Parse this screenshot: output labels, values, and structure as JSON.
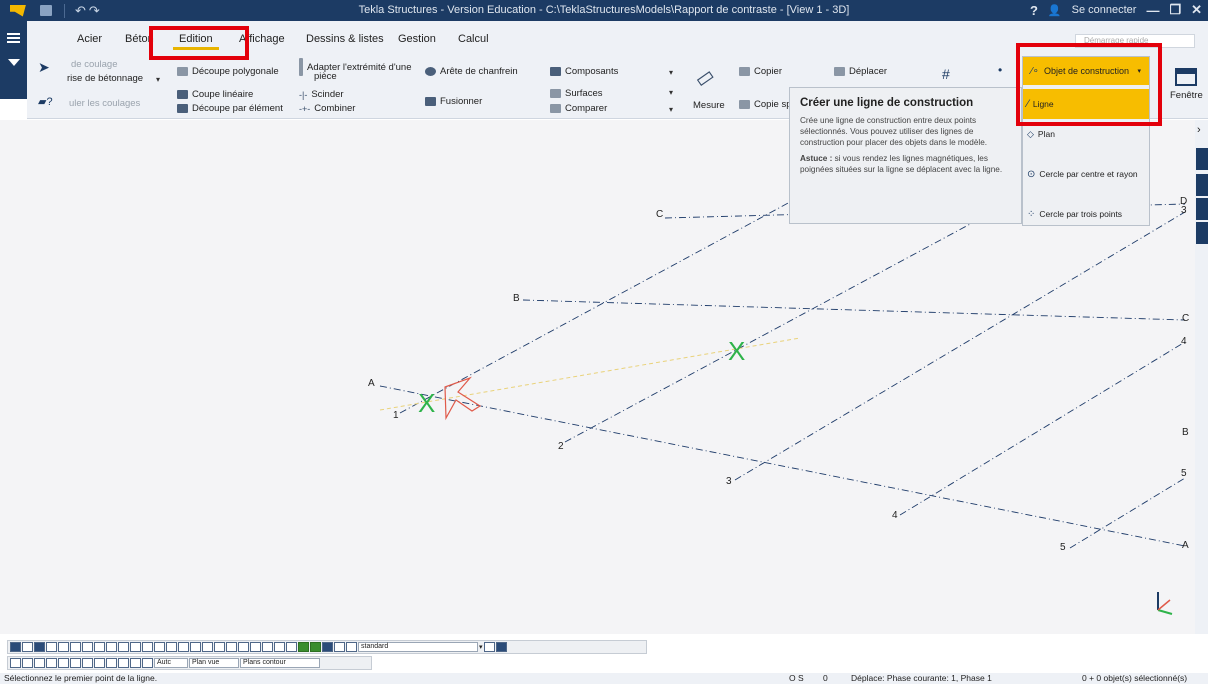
{
  "window": {
    "title": "Tekla Structures - Version Education - C:\\TeklaStructuresModels\\Rapport de contraste - [View 1 - 3D]",
    "help": "?",
    "signin": "Se connecter",
    "search_placeholder": "Démarrage rapide"
  },
  "tabs": [
    "Acier",
    "Béton",
    "Edition",
    "Affichage",
    "Dessins & listes",
    "Gestion",
    "Calcul"
  ],
  "ribbon": {
    "coulage_top": "de coulage",
    "betonnage": "rise de bétonnage",
    "couler": "uler les coulages",
    "decoupe_polygonale": "Découpe polygonale",
    "coupe_lineaire": "Coupe linéaire",
    "decoupe_element": "Découpe par élément",
    "adapter": "Adapter l'extrémité d'une",
    "adapter2": "pièce",
    "scinder": "Scinder",
    "combiner": "Combiner",
    "arete": "Arête de chanfrein",
    "fusionner": "Fusionner",
    "composants": "Composants",
    "surfaces": "Surfaces",
    "comparer": "Comparer",
    "mesure": "Mesure",
    "copier": "Copier",
    "copie_sp": "Copie sp",
    "deplacer": "Déplacer",
    "fenetre": "Fenêtre"
  },
  "tooltip": {
    "title": "Créer une ligne de construction",
    "body": "Crée une ligne de construction entre deux points sélectionnés. Vous pouvez utiliser des lignes de construction pour placer des objets dans le modèle.",
    "tip_label": "Astuce :",
    "tip": " si vous rendez les lignes magnétiques, les poignées situées sur la ligne se déplacent avec la ligne."
  },
  "menu": {
    "header": "Objet de construction",
    "items": [
      "Ligne",
      "Plan",
      "Cercle par centre et rayon",
      "Cercle par trois points"
    ]
  },
  "grid_labels": {
    "letters_left": [
      "A",
      "B",
      "C",
      "D"
    ],
    "letters_right": [
      "C",
      "B",
      "A"
    ],
    "numbers_bottom": [
      "1",
      "2",
      "3",
      "4",
      "5"
    ],
    "numbers_right": [
      "3",
      "4",
      "5"
    ]
  },
  "toolbar": {
    "view_select": "standard",
    "auto": "Autc",
    "plan_vue": "Plan vue",
    "plans_contour": "Plans contour"
  },
  "status": {
    "prompt": "Sélectionnez le premier point de la ligne.",
    "os": "O S",
    "zero": "0",
    "phase": "Déplace: Phase courante: 1, Phase 1",
    "selection": "0 + 0 objet(s) sélectionné(s)"
  },
  "colors": {
    "titlebar": "#1c3b64",
    "accent": "#f7bd00",
    "highlight_box": "#e3000b",
    "marker": "#2eb34a"
  }
}
